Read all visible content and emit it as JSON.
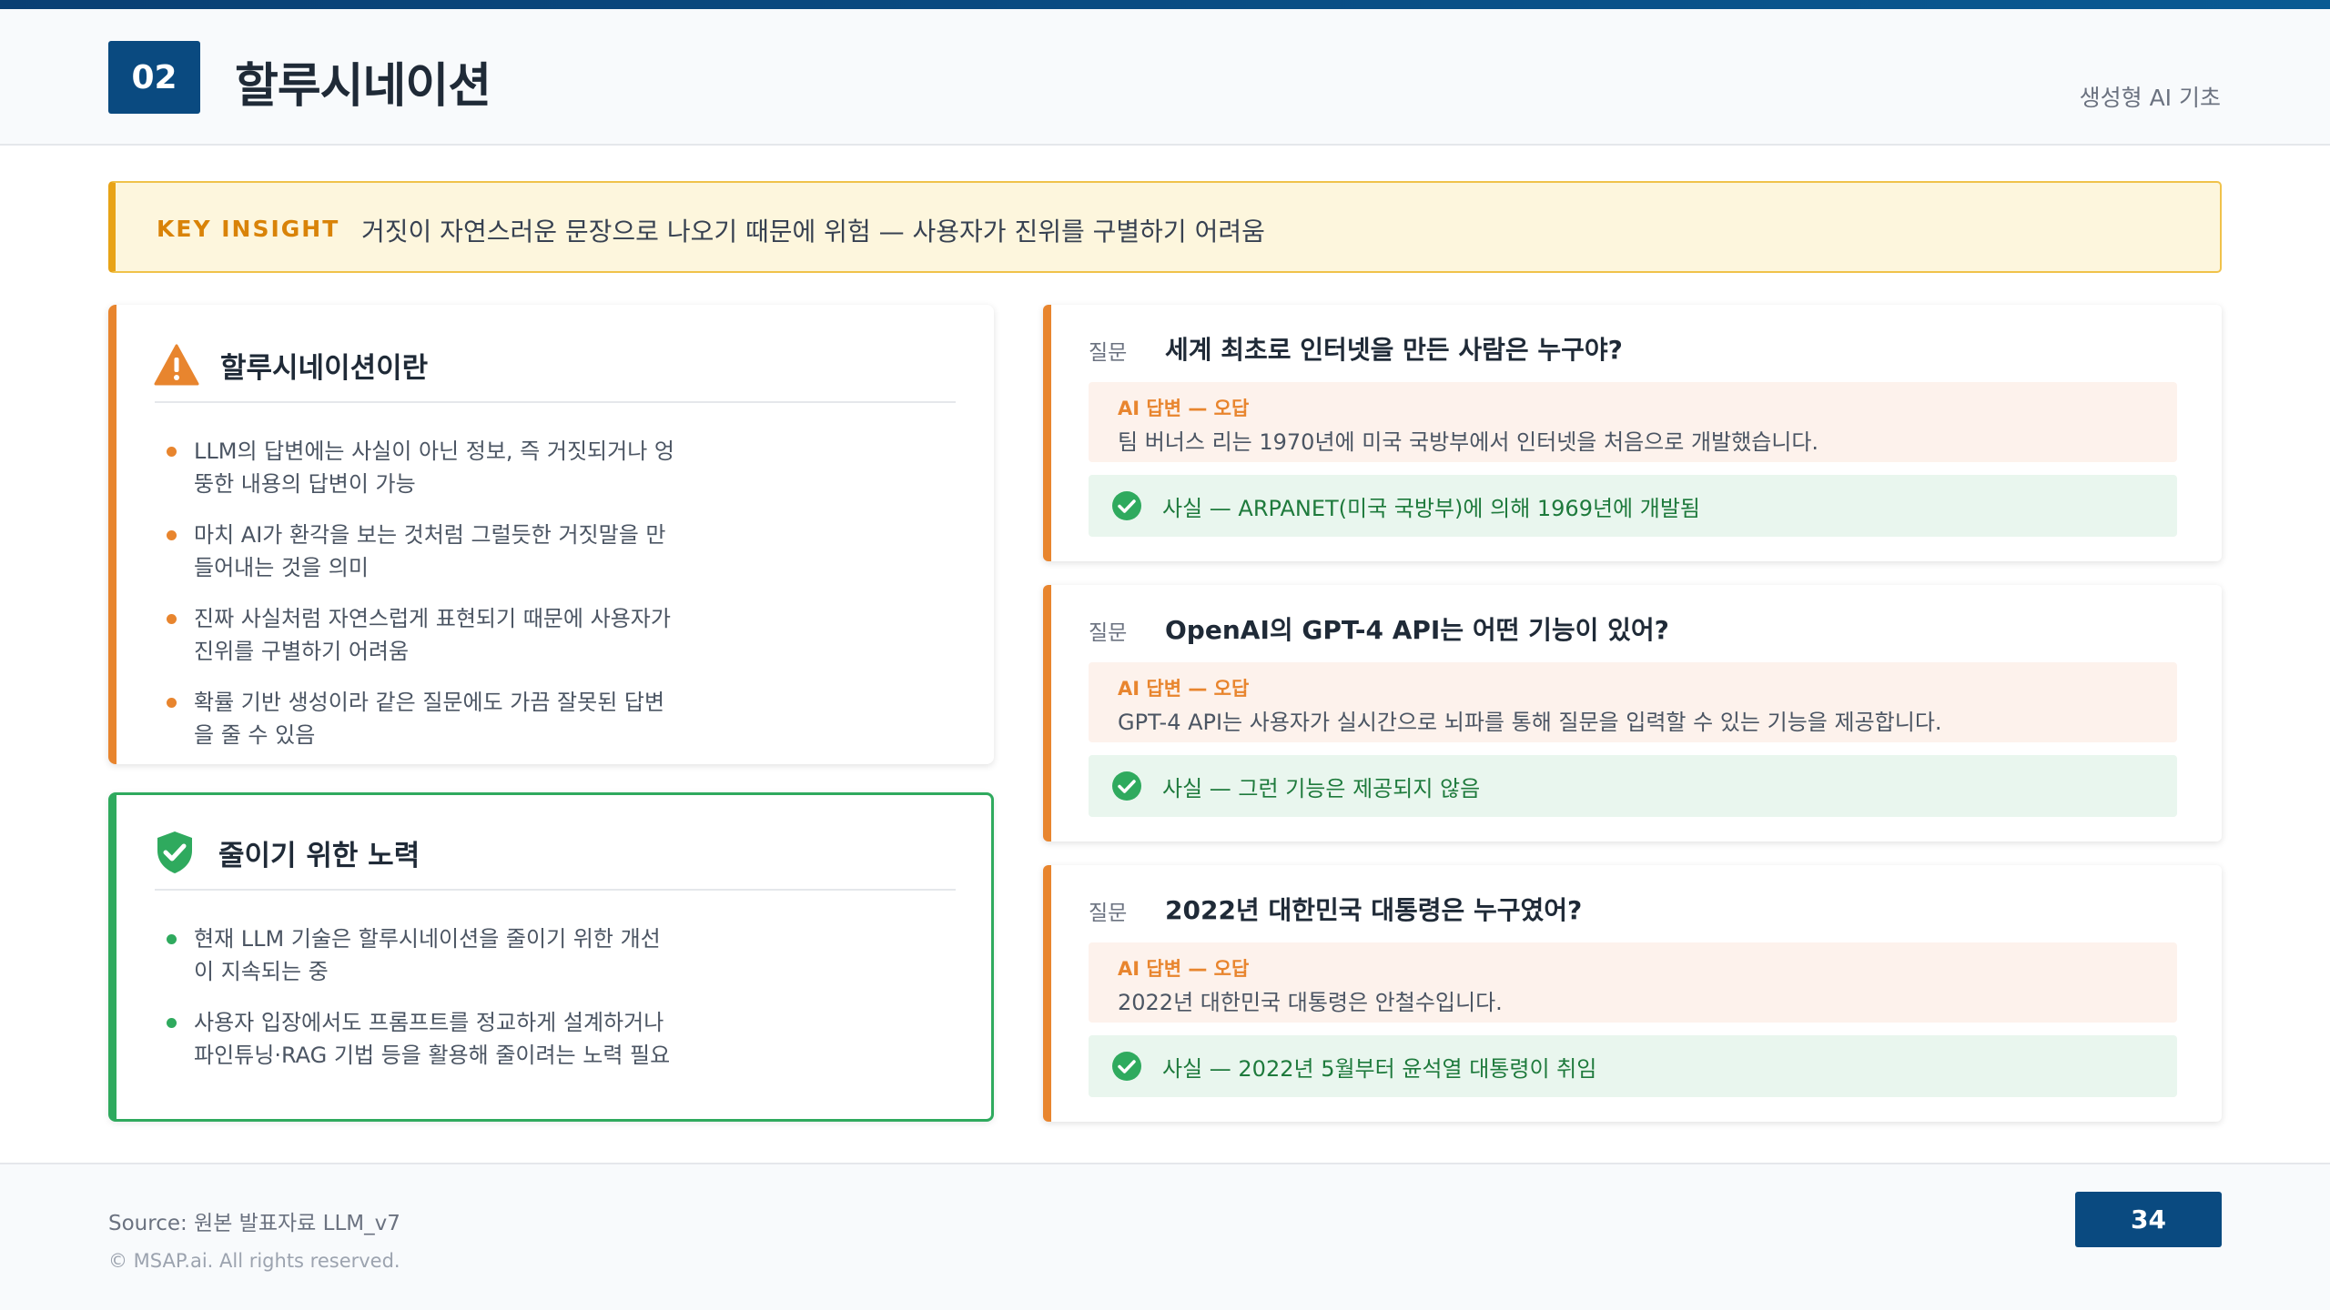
{
  "header": {
    "number": "02",
    "title": "할루시네이션",
    "course": "생성형 AI 기초"
  },
  "insight": {
    "tag": "KEY INSIGHT",
    "text": "거짓이 자연스러운 문장으로 나오기 때문에 위험 — 사용자가 진위를 구별하기 어려움"
  },
  "definition_card": {
    "icon": "warning-icon",
    "title": "할루시네이션이란",
    "bullets": [
      "LLM의 답변에는 사실이 아닌 정보, 즉 거짓되거나 엉뚱한 내용의 답변이 가능",
      "마치 AI가 환각을 보는 것처럼 그럴듯한 거짓말을 만들어내는 것을 의미",
      "진짜 사실처럼 자연스럽게 표현되기 때문에 사용자가 진위를 구별하기 어려움",
      "확률 기반 생성이라 같은 질문에도 가끔 잘못된 답변을 줄 수 있음"
    ]
  },
  "mitigation_card": {
    "icon": "shield-check-icon",
    "title": "줄이기 위한 노력",
    "bullets": [
      "현재 LLM 기술은 할루시네이션을 줄이기 위한 개선이 지속되는 중",
      "사용자 입장에서도 프롬프트를 정교하게 설계하거나 파인튜닝·RAG 기법 등을 활용해 줄이려는 노력 필요"
    ]
  },
  "examples": [
    {
      "q_label": "질문",
      "question": "세계 최초로 인터넷을 만든 사람은 누구야?",
      "ai_label": "AI 답변 — 오답",
      "ai_answer": "팀 버너스 리는 1970년에 미국 국방부에서 인터넷을 처음으로 개발했습니다.",
      "fact": "사실 — ARPANET(미국 국방부)에 의해 1969년에 개발됨"
    },
    {
      "q_label": "질문",
      "question": "OpenAI의 GPT-4 API는 어떤 기능이 있어?",
      "ai_label": "AI 답변 — 오답",
      "ai_answer": "GPT-4 API는 사용자가 실시간으로 뇌파를 통해 질문을 입력할 수 있는 기능을 제공합니다.",
      "fact": "사실 — 그런 기능은 제공되지 않음"
    },
    {
      "q_label": "질문",
      "question": "2022년 대한민국 대통령은 누구였어?",
      "ai_label": "AI 답변 — 오답",
      "ai_answer": "2022년 대한민국 대통령은 안철수입니다.",
      "fact": "사실 — 2022년 5월부터 윤석열 대통령이 취임"
    }
  ],
  "footer": {
    "source": "Source: 원본 발표자료 LLM_v7",
    "copyright": "© MSAP.ai. All rights reserved.",
    "page": "34"
  },
  "colors": {
    "brand": "#0a4a80",
    "accent_orange": "#e8852e",
    "accent_green": "#2faa5e",
    "insight_bg": "#fdf6dd"
  }
}
